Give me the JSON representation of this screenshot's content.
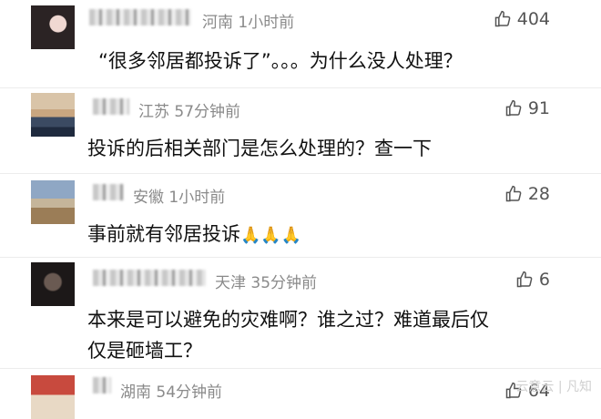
{
  "comments": [
    {
      "location": "河南",
      "time": "1小时前",
      "likes": "404",
      "text": "“很多邻居都投诉了”。。。为什么没人处理？"
    },
    {
      "location": "江苏",
      "time": "57分钟前",
      "likes": "91",
      "text": "投诉的后相关部门是怎么处理的？查一下"
    },
    {
      "location": "安徽",
      "time": "1小时前",
      "likes": "28",
      "text": "事前就有邻居投诉"
    },
    {
      "location": "天津",
      "time": "35分钟前",
      "likes": "6",
      "text": "本来是可以避免的灾难啊？谁之过？难道最后仅仅是砸墙工？"
    },
    {
      "location": "湖南",
      "time": "54分钟前",
      "likes": "64",
      "text": ""
    }
  ],
  "emoji": "🙏🙏🙏",
  "icons": {
    "like": "thumbs-up-icon",
    "avatar": "avatar-image"
  },
  "watermark": "云意云 | 凡知"
}
